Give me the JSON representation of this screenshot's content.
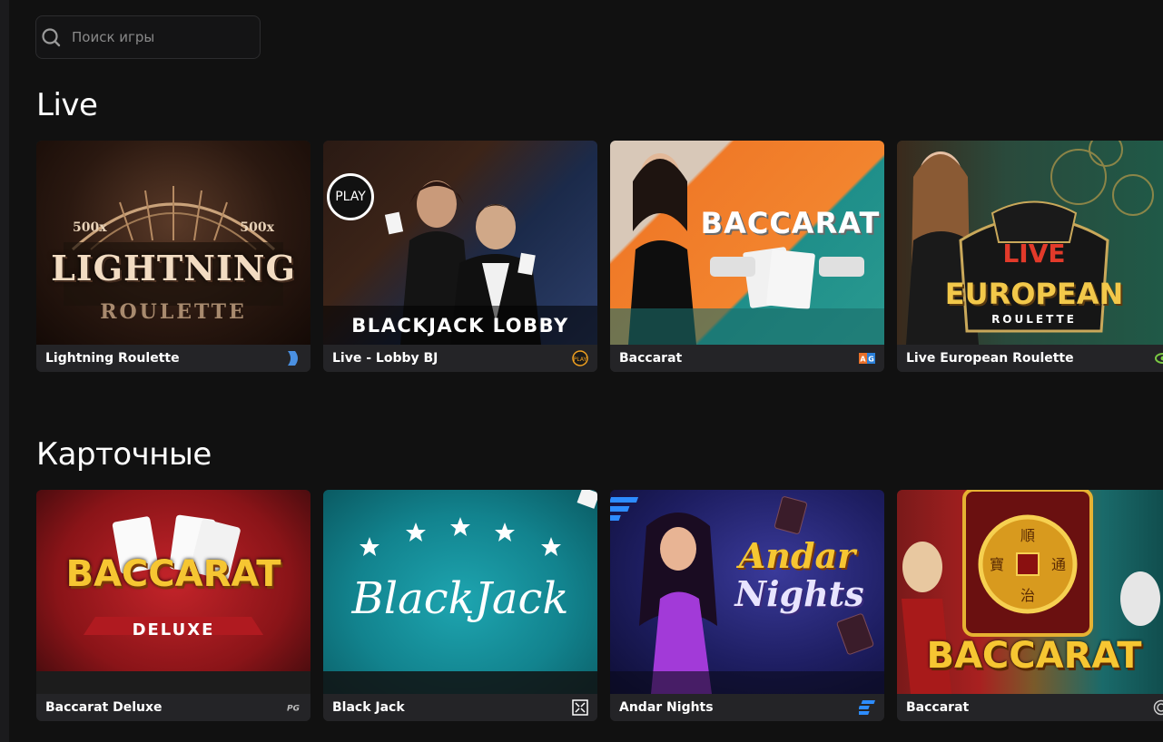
{
  "search": {
    "placeholder": "Поиск игры"
  },
  "sections": [
    {
      "title": "Live",
      "games": [
        {
          "name": "Lightning Roulette",
          "art_title": "LIGHTNING",
          "art_subtitle": "ROULETTE",
          "art_top_left": "500x",
          "art_top_right": "500x",
          "provider_icon": "evolution-icon",
          "provider_color": "#4a90e2"
        },
        {
          "name": "Live - Lobby BJ",
          "art_title": "BLACKJACK LOBBY",
          "art_badge": "PLAY",
          "provider_icon": "pragmatic-play-icon",
          "provider_color": "#f0a020"
        },
        {
          "name": "Baccarat",
          "art_title": "BACCARAT",
          "provider_icon": "asia-gaming-icon",
          "provider_color": "#e8702a"
        },
        {
          "name": "Live European Roulette",
          "art_badge": "LIVE",
          "art_title": "EUROPEAN",
          "art_subtitle": "ROULETTE",
          "provider_icon": "eye-icon",
          "provider_color": "#7ac943"
        }
      ]
    },
    {
      "title": "Карточные",
      "games": [
        {
          "name": "Baccarat Deluxe",
          "art_title": "BACCARAT",
          "art_subtitle": "DELUXE",
          "provider_icon": "pg-icon",
          "provider_color": "#bbbbbb"
        },
        {
          "name": "Black Jack",
          "art_title": "BlackJack",
          "provider_icon": "provider-pattern-icon",
          "provider_color": "#ffffff"
        },
        {
          "name": "Andar Nights",
          "art_title": "Andar",
          "art_subtitle": "Nights",
          "provider_icon": "stripes-icon",
          "provider_color": "#2d8cff"
        },
        {
          "name": "Baccarat",
          "art_title": "BACCARAT",
          "provider_icon": "circle-logo-icon",
          "provider_color": "#cccccc"
        }
      ]
    }
  ]
}
